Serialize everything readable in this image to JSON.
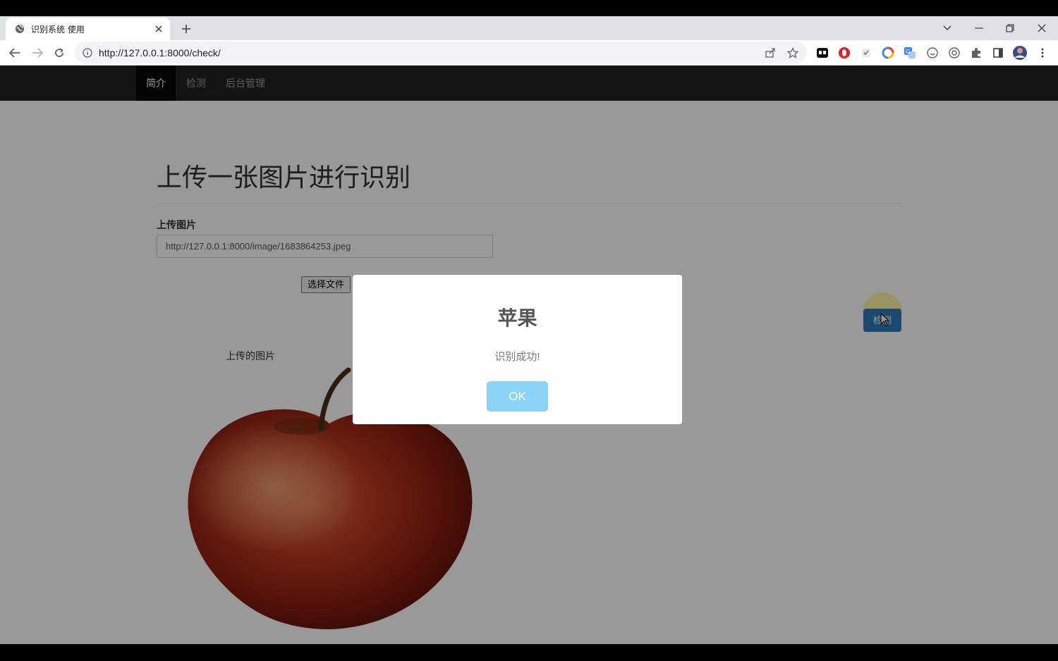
{
  "browser": {
    "tab_title": "识别系统 使用",
    "url": "http://127.0.0.1:8000/check/"
  },
  "navbar": {
    "items": [
      {
        "label": "简介",
        "active": true
      },
      {
        "label": "检测",
        "active": false
      },
      {
        "label": "后台管理",
        "active": false
      }
    ]
  },
  "page": {
    "title": "上传一张图片进行识别",
    "upload_label": "上传图片",
    "image_url_value": "http://127.0.0.1:8000/image/1683864253.jpeg",
    "choose_file_label": "选择文件",
    "uploaded_caption": "上传的图片",
    "detect_button_label": "检测"
  },
  "modal": {
    "title": "苹果",
    "message": "识别成功!",
    "ok_label": "OK"
  },
  "colors": {
    "navbar_bg": "#222222",
    "detect_button": "#337ab7",
    "ok_button": "#8cd4f5",
    "overlay": "rgba(0,0,0,0.4)"
  }
}
